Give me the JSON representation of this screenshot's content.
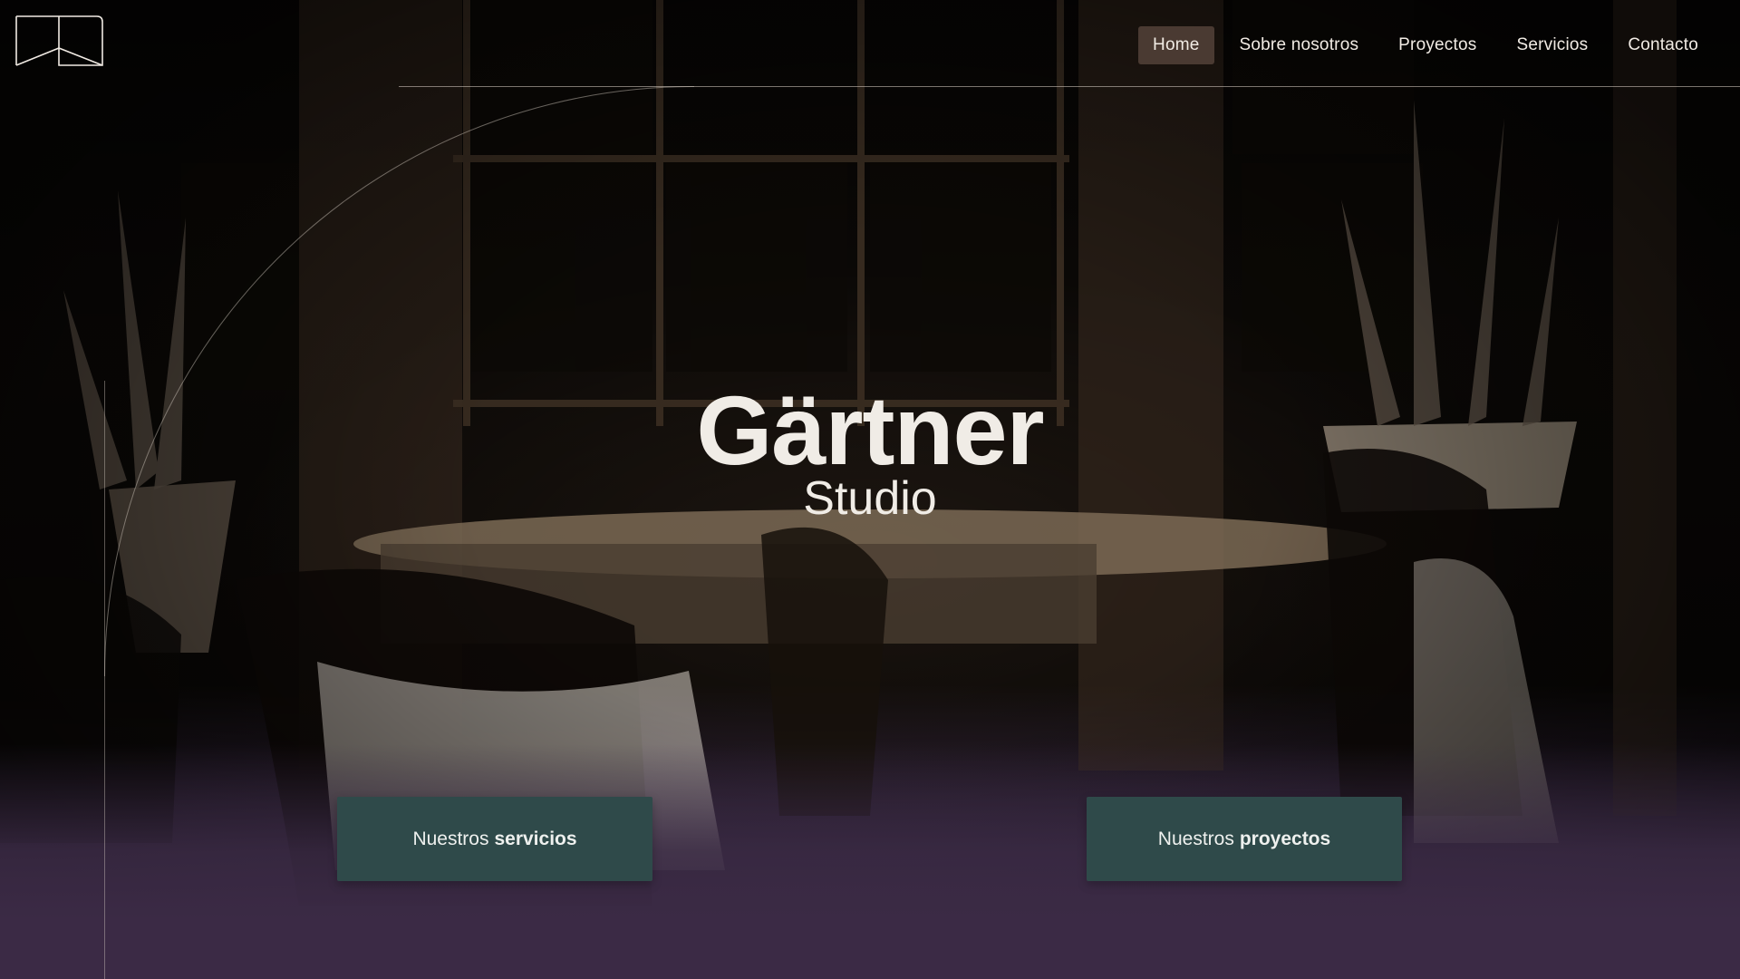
{
  "brand": {
    "logo_icon": "studio-logo-mark"
  },
  "nav": {
    "items": [
      {
        "label": "Home",
        "active": true
      },
      {
        "label": "Sobre nosotros",
        "active": false
      },
      {
        "label": "Proyectos",
        "active": false
      },
      {
        "label": "Servicios",
        "active": false
      },
      {
        "label": "Contacto",
        "active": false
      }
    ]
  },
  "hero": {
    "title": "Gärtner",
    "subtitle": "Studio"
  },
  "cta": {
    "services": {
      "prefix": "Nuestros",
      "emphasis": "servicios"
    },
    "projects": {
      "prefix": "Nuestros",
      "emphasis": "proyectos"
    }
  },
  "colors": {
    "nav_active_bg": "#4a3a32",
    "button_bg": "#2f4a4a",
    "footer_bg": "#3a2a44",
    "text_light": "#f0ece6"
  }
}
